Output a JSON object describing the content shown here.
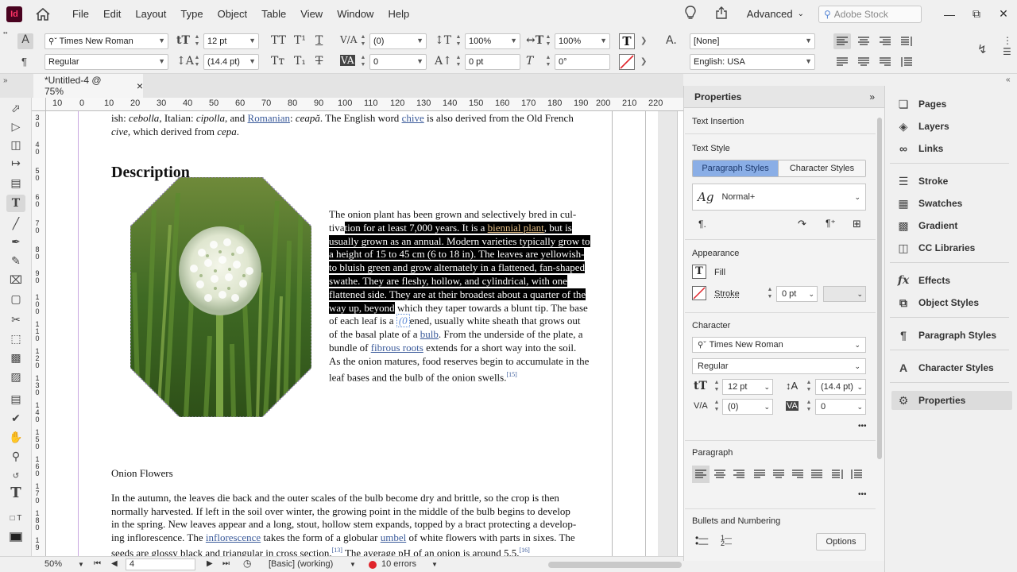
{
  "app": {
    "logo_text": "Id"
  },
  "menu": [
    "File",
    "Edit",
    "Layout",
    "Type",
    "Object",
    "Table",
    "View",
    "Window",
    "Help"
  ],
  "workspace": {
    "label": "Advanced",
    "search_placeholder": "Adobe Stock"
  },
  "control": {
    "font_family": "Times New Roman",
    "font_style": "Regular",
    "font_size": "12 pt",
    "leading": "(14.4 pt)",
    "kerning": "(0)",
    "tracking": "0",
    "vscale": "100%",
    "hscale": "100%",
    "baseline": "0 pt",
    "skew": "0°",
    "char_style": "[None]",
    "language": "English: USA"
  },
  "doc_tab": {
    "title": "*Untitled-4 @ 75%",
    "close": "×"
  },
  "ruler_h": [
    "10",
    "0",
    "10",
    "20",
    "30",
    "40",
    "50",
    "60",
    "70",
    "80",
    "90",
    "100",
    "110",
    "120",
    "130",
    "140",
    "150",
    "160",
    "170",
    "180",
    "190",
    "200",
    "210",
    "220"
  ],
  "document": {
    "intro_line1": {
      "a": "ish: ",
      "b": "cebolla",
      "c": ", Italian: ",
      "d": "cipolla",
      "e": ", and ",
      "f": "Romanian",
      "g": ": ",
      "h": "ceapă",
      "i": ". The English word ",
      "j": "chive",
      "k": " is also derived from the Old French"
    },
    "intro_line2": {
      "a": "cive",
      "b": ", which derived from ",
      "c": "cepa",
      "d": "."
    },
    "heading": "Description",
    "body": {
      "l1": "The onion plant has been grown and selectively bred in cul-",
      "l2a": "tiva",
      "l2b": "tion for at least 7,000 years. It is a ",
      "l2c": "biennial plant",
      "l2d": ", but is",
      "l3": "usually grown as an annual. Modern varieties typically grow to",
      "l4": "a height of 15 to 45 cm (6 to 18 in). The leaves are yellowish-",
      "l5": "to bluish green and grow alternately in a flattened, fan-shaped",
      "l6": "swathe. They are fleshy, hollow, and cylindrical, with one",
      "l7": "flattened side. They are at their broadest about a quarter of the",
      "l8a": "way up, beyond",
      "l8b": " which they taper towards a blunt tip. The base",
      "l9a": "of each leaf is a ",
      "l9b": "(0",
      "l9c": "ened, usually white sheath that grows out",
      "l10a": "of the basal plate of a ",
      "l10b": "bulb",
      "l10c": ". From the underside of the plate, a",
      "l11a": "bundle of ",
      "l11b": "fibrous roots",
      "l11c": " extends for a short way into the soil.",
      "l12": "As the onion matures, food reserves begin to accumulate in the",
      "l13": "leaf bases and the bulb of the onion swells.",
      "l13sup": "[15]"
    },
    "section_title": "Onion Flowers",
    "para2": {
      "l1": "In the autumn, the leaves die back and the outer scales of the bulb become dry and brittle, so the crop is then",
      "l2": "normally harvested. If left in the soil over winter, the growing point in the middle of the bulb begins to develop",
      "l3": "in the spring. New leaves appear and a long, stout, hollow stem expands, topped by a bract protecting a develop-",
      "l4a": "ing inflorescence. The ",
      "l4b": "inflorescence",
      "l4c": " takes the form of a globular ",
      "l4d": "umbel",
      "l4e": " of white flowers with parts in sixes. The",
      "l5a": "seeds are glossy black and triangular in cross section.",
      "l5sup": "[13]",
      "l5b": " The average pH of an onion is around 5.5.",
      "l5sup2": "[16]"
    }
  },
  "status": {
    "zoom": "50%",
    "page": "4",
    "preflight_profile": "[Basic] (working)",
    "errors": "10 errors"
  },
  "properties": {
    "title": "Properties",
    "text_insertion": "Text Insertion",
    "text_style": "Text Style",
    "tab_paragraph": "Paragraph Styles",
    "tab_character": "Character Styles",
    "style_name": "Normal+",
    "style_prefix": "Ag",
    "appearance": "Appearance",
    "fill": "Fill",
    "stroke": "Stroke",
    "stroke_weight": "0 pt",
    "character": "Character",
    "font_family": "Times New Roman",
    "font_style": "Regular",
    "font_size": "12 pt",
    "leading": "(14.4 pt)",
    "kerning": "(0)",
    "tracking": "0",
    "paragraph": "Paragraph",
    "bullets": "Bullets and Numbering",
    "options": "Options",
    "more": "•••"
  },
  "dock": {
    "items": [
      "Pages",
      "Layers",
      "Links",
      "Stroke",
      "Swatches",
      "Gradient",
      "CC Libraries",
      "Effects",
      "Object Styles",
      "Paragraph Styles",
      "Character Styles",
      "Properties"
    ]
  },
  "colors": {
    "accent": "#5c8ad6",
    "error": "#e0242b",
    "link": "#3a5a9a",
    "logo_bg": "#49021f",
    "logo_fg": "#ff3366"
  }
}
